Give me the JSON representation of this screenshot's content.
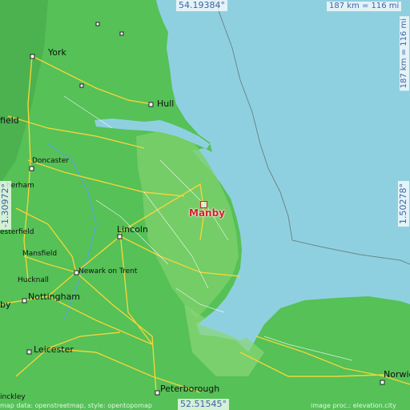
{
  "map": {
    "marker_place": "Manby",
    "coords": {
      "top": "54.19384°",
      "bottom": "52.51545°",
      "left": "-1.30972°",
      "right": "1.50278°"
    },
    "scale": {
      "horizontal": "187 km = 116 mi",
      "vertical": "187 km = 116 mi"
    },
    "attribution_left": "map data: openstreetmap, style: opentopomap",
    "attribution_right": "image proc.: elevation.city",
    "colors": {
      "sea": "#8fd0e0",
      "land": "#55c157",
      "lowland": "#7cd06a",
      "roads": "#f2d53a",
      "marker": "#d81e2a"
    },
    "cities": [
      {
        "name": "York"
      },
      {
        "name": "Hull"
      },
      {
        "name": "field"
      },
      {
        "name": "Doncaster"
      },
      {
        "name": "herham"
      },
      {
        "name": "esterfield"
      },
      {
        "name": "Mansfield"
      },
      {
        "name": "Lincoln"
      },
      {
        "name": "Newark on Trent"
      },
      {
        "name": "Hucknall"
      },
      {
        "name": "Nottingham"
      },
      {
        "name": "Leicester"
      },
      {
        "name": "Peterborough"
      },
      {
        "name": "Norwich"
      },
      {
        "name": "inckley"
      },
      {
        "name": "by"
      }
    ]
  }
}
